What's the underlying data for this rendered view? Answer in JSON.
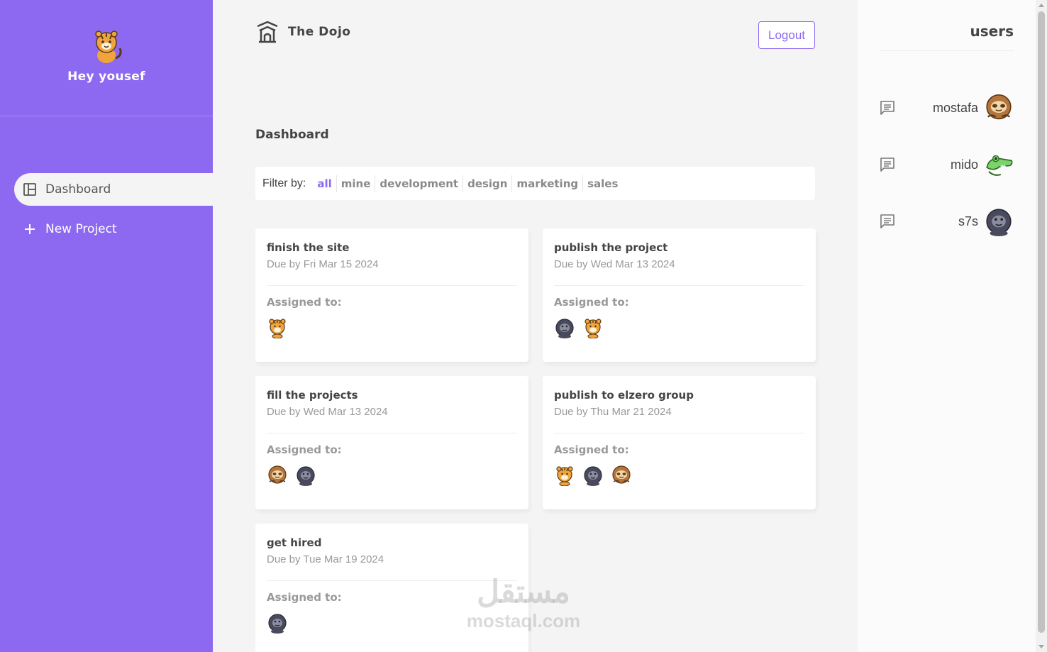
{
  "sidebar": {
    "greeting": "Hey yousef",
    "nav": [
      {
        "label": "Dashboard",
        "icon": "dashboard-icon",
        "active": true
      },
      {
        "label": "New Project",
        "icon": "plus-icon",
        "active": false
      }
    ]
  },
  "header": {
    "title": "The Dojo",
    "logout_label": "Logout"
  },
  "page_title": "Dashboard",
  "filter": {
    "label": "Filter by:",
    "options": [
      "all",
      "mine",
      "development",
      "design",
      "marketing",
      "sales"
    ],
    "active": "all"
  },
  "projects": [
    {
      "title": "finish the site",
      "due": "Due by Fri Mar 15 2024",
      "assigned_label": "Assigned to:",
      "avatars": [
        "tiger"
      ]
    },
    {
      "title": "publish the project",
      "due": "Due by Wed Mar 13 2024",
      "assigned_label": "Assigned to:",
      "avatars": [
        "gorilla",
        "tiger"
      ]
    },
    {
      "title": "fill the projects",
      "due": "Due by Wed Mar 13 2024",
      "assigned_label": "Assigned to:",
      "avatars": [
        "sloth",
        "gorilla"
      ]
    },
    {
      "title": "publish to elzero group",
      "due": "Due by Thu Mar 21 2024",
      "assigned_label": "Assigned to:",
      "avatars": [
        "tiger",
        "gorilla",
        "sloth"
      ]
    },
    {
      "title": "get hired",
      "due": "Due by Tue Mar 19 2024",
      "assigned_label": "Assigned to:",
      "avatars": [
        "gorilla"
      ]
    }
  ],
  "users_panel": {
    "title": "users",
    "users": [
      {
        "name": "mostafa",
        "avatar": "sloth"
      },
      {
        "name": "mido",
        "avatar": "crocodile"
      },
      {
        "name": "s7s",
        "avatar": "gorilla"
      }
    ]
  },
  "watermark": {
    "arabic": "مستقل",
    "latin": "mostaql.com"
  },
  "colors": {
    "accent": "#8d69f1",
    "background": "#f4f4f4"
  }
}
